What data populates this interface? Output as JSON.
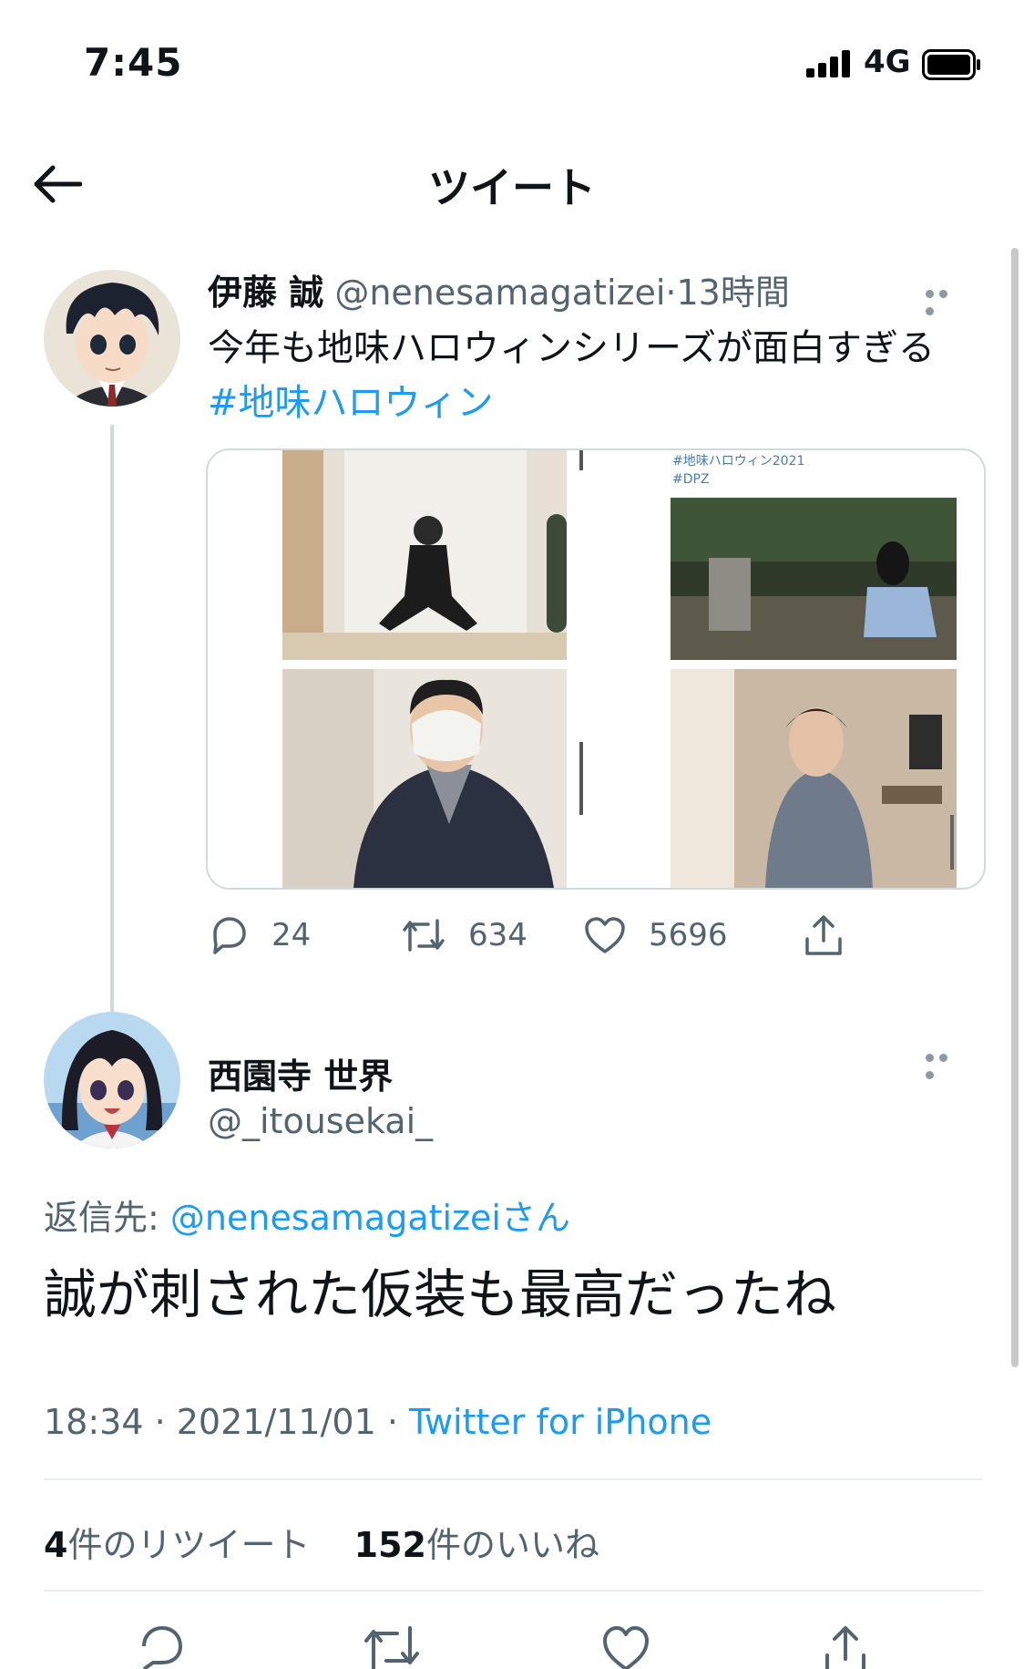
{
  "status_bar": {
    "time": "7:45",
    "network": "4G"
  },
  "nav": {
    "title": "ツイート"
  },
  "original_tweet": {
    "name": "伊藤 誠",
    "handle": "@nenesamagatizei",
    "separator": "·",
    "time": "13時間",
    "text": "今年も地味ハロウィンシリーズが面白すぎる",
    "hashtag": "#地味ハロウィン",
    "media_overlay": [
      "#地味ハロウィン2021",
      "#DPZ"
    ],
    "counts": {
      "replies": "24",
      "retweets": "634",
      "likes": "5696"
    }
  },
  "reply_tweet": {
    "name": "西園寺 世界",
    "handle": "@_itousekai_",
    "replying_prefix": "返信先: ",
    "replying_to": "@nenesamagatizeiさん",
    "text": "誠が刺された仮装も最高だったね",
    "timestamp": "18:34 · 2021/11/01",
    "separator": " · ",
    "source": "Twitter for iPhone",
    "retweet_count": "4",
    "retweet_label": "件のリツイート",
    "like_count": "152",
    "like_label": "件のいいね"
  },
  "colors": {
    "accent": "#1d9bf0",
    "secondary_text": "#536471",
    "divider": "#e6ecf0"
  },
  "icons": [
    "back-arrow-icon",
    "more-icon",
    "reply-icon",
    "retweet-icon",
    "like-icon",
    "share-icon"
  ]
}
